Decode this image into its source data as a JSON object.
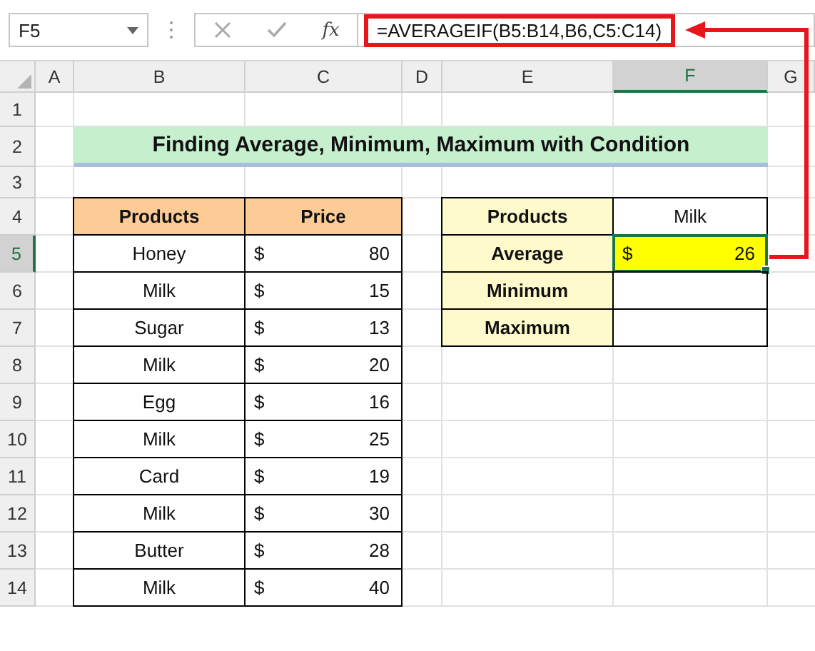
{
  "name_box": {
    "value": "F5"
  },
  "formula_bar": {
    "function_label": "fx",
    "formula": "=AVERAGEIF(B5:B14,B6,C5:C14)"
  },
  "columns": [
    {
      "label": "A",
      "selected": false
    },
    {
      "label": "B",
      "selected": false
    },
    {
      "label": "C",
      "selected": false
    },
    {
      "label": "D",
      "selected": false
    },
    {
      "label": "E",
      "selected": false
    },
    {
      "label": "F",
      "selected": true
    },
    {
      "label": "G",
      "selected": false
    }
  ],
  "rows": [
    {
      "label": "1",
      "selected": false
    },
    {
      "label": "2",
      "selected": false
    },
    {
      "label": "3",
      "selected": false
    },
    {
      "label": "4",
      "selected": false
    },
    {
      "label": "5",
      "selected": true
    },
    {
      "label": "6",
      "selected": false
    },
    {
      "label": "7",
      "selected": false
    },
    {
      "label": "8",
      "selected": false
    },
    {
      "label": "9",
      "selected": false
    },
    {
      "label": "10",
      "selected": false
    },
    {
      "label": "11",
      "selected": false
    },
    {
      "label": "12",
      "selected": false
    },
    {
      "label": "13",
      "selected": false
    },
    {
      "label": "14",
      "selected": false
    }
  ],
  "title": "Finding Average, Minimum, Maximum with Condition",
  "table": {
    "columns": [
      "Products",
      "Price"
    ],
    "rows": [
      {
        "product": "Honey",
        "currency": "$",
        "price": "80"
      },
      {
        "product": "Milk",
        "currency": "$",
        "price": "15"
      },
      {
        "product": "Sugar",
        "currency": "$",
        "price": "13"
      },
      {
        "product": "Milk",
        "currency": "$",
        "price": "20"
      },
      {
        "product": "Egg",
        "currency": "$",
        "price": "16"
      },
      {
        "product": "Milk",
        "currency": "$",
        "price": "25"
      },
      {
        "product": "Card",
        "currency": "$",
        "price": "19"
      },
      {
        "product": "Milk",
        "currency": "$",
        "price": "30"
      },
      {
        "product": "Butter",
        "currency": "$",
        "price": "28"
      },
      {
        "product": "Milk",
        "currency": "$",
        "price": "40"
      }
    ]
  },
  "summary": {
    "rows": [
      {
        "label": "Products",
        "value": "Milk",
        "selected": false
      },
      {
        "label": "Average",
        "currency": "$",
        "value": "26",
        "selected": true
      },
      {
        "label": "Minimum",
        "selected": false
      },
      {
        "label": "Maximum",
        "selected": false
      }
    ]
  }
}
